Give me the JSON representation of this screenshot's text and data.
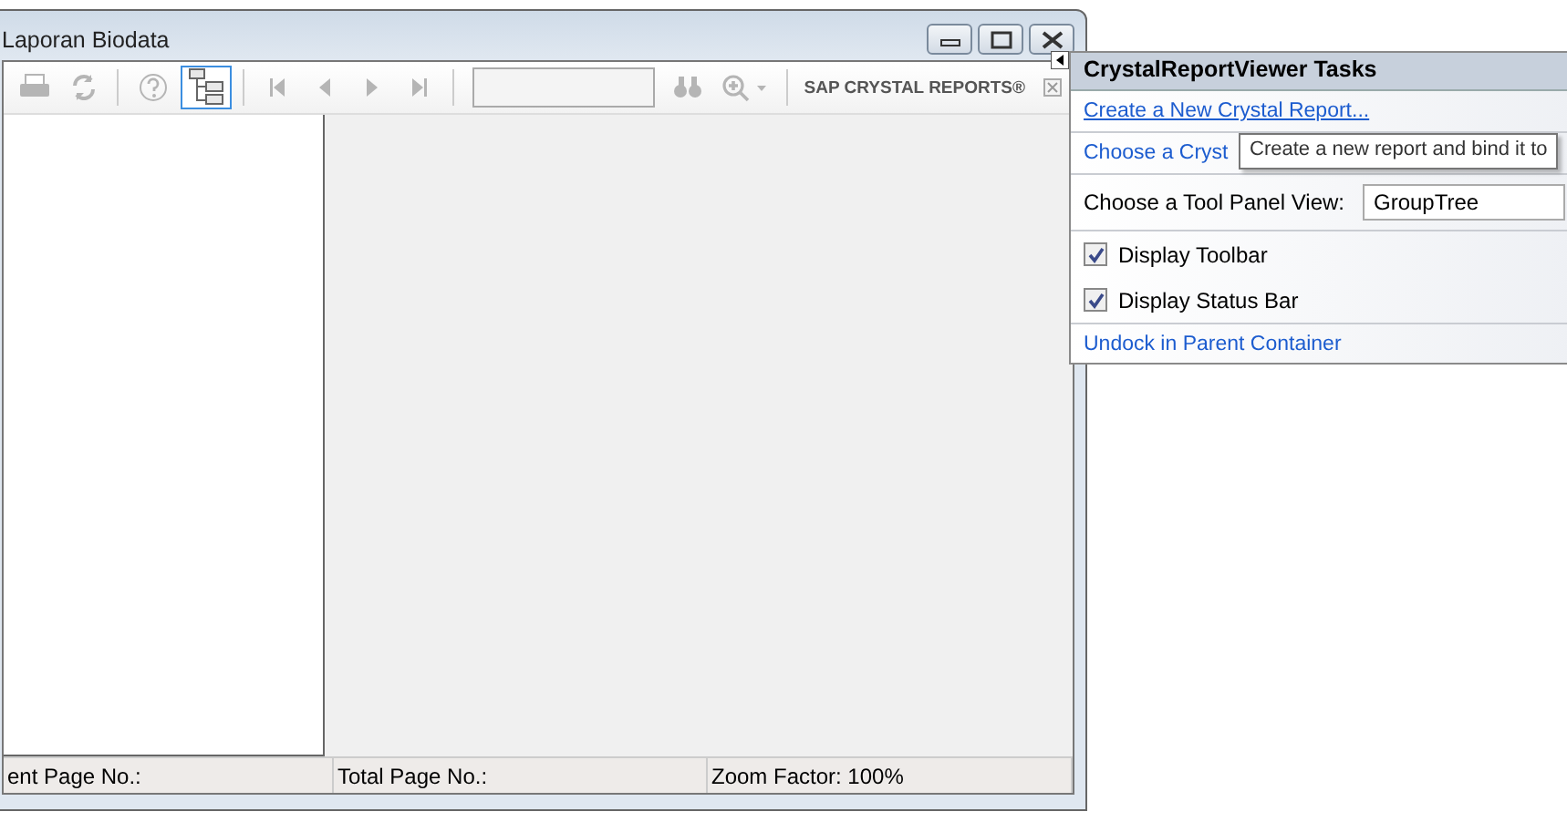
{
  "window": {
    "title": "Laporan Biodata"
  },
  "toolbar": {
    "buttons": [
      {
        "kind": "print",
        "disabled": true
      },
      {
        "kind": "refresh",
        "disabled": true
      },
      {
        "kind": "sep"
      },
      {
        "kind": "help",
        "disabled": true
      },
      {
        "kind": "tree",
        "disabled": false,
        "on": true
      },
      {
        "kind": "sep"
      },
      {
        "kind": "first",
        "disabled": true
      },
      {
        "kind": "prev",
        "disabled": true
      },
      {
        "kind": "next",
        "disabled": true
      },
      {
        "kind": "last",
        "disabled": true
      },
      {
        "kind": "sep"
      },
      {
        "kind": "pagefield",
        "disabled": true
      },
      {
        "kind": "find",
        "disabled": true
      },
      {
        "kind": "zoom",
        "disabled": true
      },
      {
        "kind": "sep"
      }
    ],
    "brand": "SAP CRYSTAL REPORTS®"
  },
  "status_bar": [
    "ent Page No.:",
    "Total Page No.:",
    "Zoom Factor: 100%"
  ],
  "tasks_panel": {
    "title": "CrystalReportViewer Tasks",
    "items": [
      {
        "kind": "link",
        "text": "Create a New Crystal Report..."
      },
      {
        "kind": "link",
        "text": "Choose a Cryst"
      },
      {
        "kind": "select",
        "label": "Choose a Tool Panel View:",
        "value": "GroupTree"
      },
      {
        "kind": "check",
        "label": "Display Toolbar",
        "checked": true
      },
      {
        "kind": "check",
        "label": "Display Status Bar",
        "checked": true
      },
      {
        "kind": "link",
        "text": "Undock in Parent Container"
      }
    ]
  },
  "tooltip": "Create a new report and bind it to"
}
